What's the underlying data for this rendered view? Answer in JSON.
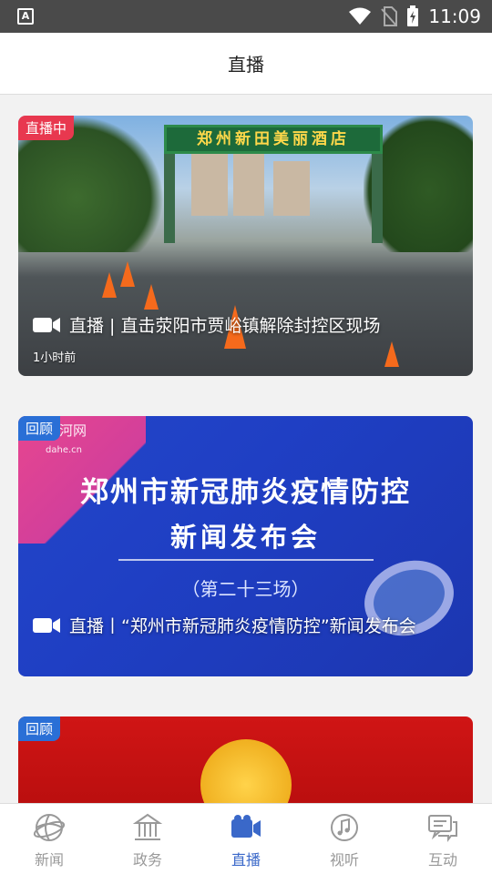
{
  "status_bar": {
    "time": "11:09"
  },
  "header": {
    "title": "直播"
  },
  "cards": [
    {
      "badge": "直播中",
      "title": "直播 | 直击荥阳市贾峪镇解除封控区现场",
      "time": "1小时前",
      "sign": "郑州新田美丽酒店"
    },
    {
      "badge": "回顾",
      "title": "直播丨“郑州市新冠肺炎疫情防控”新闻发布会",
      "logo": "大河网",
      "logo_sub": "dahe.cn",
      "poster_line1": "郑州市新冠肺炎疫情防控",
      "poster_line2": "新闻发布会",
      "poster_line3": "（第二十三场）"
    },
    {
      "badge": "回顾"
    }
  ],
  "tabbar": [
    {
      "label": "新闻",
      "icon": "globe-icon",
      "active": false
    },
    {
      "label": "政务",
      "icon": "government-building-icon",
      "active": false
    },
    {
      "label": "直播",
      "icon": "video-camera-icon",
      "active": true
    },
    {
      "label": "视听",
      "icon": "music-note-icon",
      "active": false
    },
    {
      "label": "互动",
      "icon": "chat-bubbles-icon",
      "active": false
    }
  ],
  "colors": {
    "active_tab": "#3a68c9",
    "live_badge": "#e8384f",
    "replay_badge": "#2a6fd6"
  }
}
